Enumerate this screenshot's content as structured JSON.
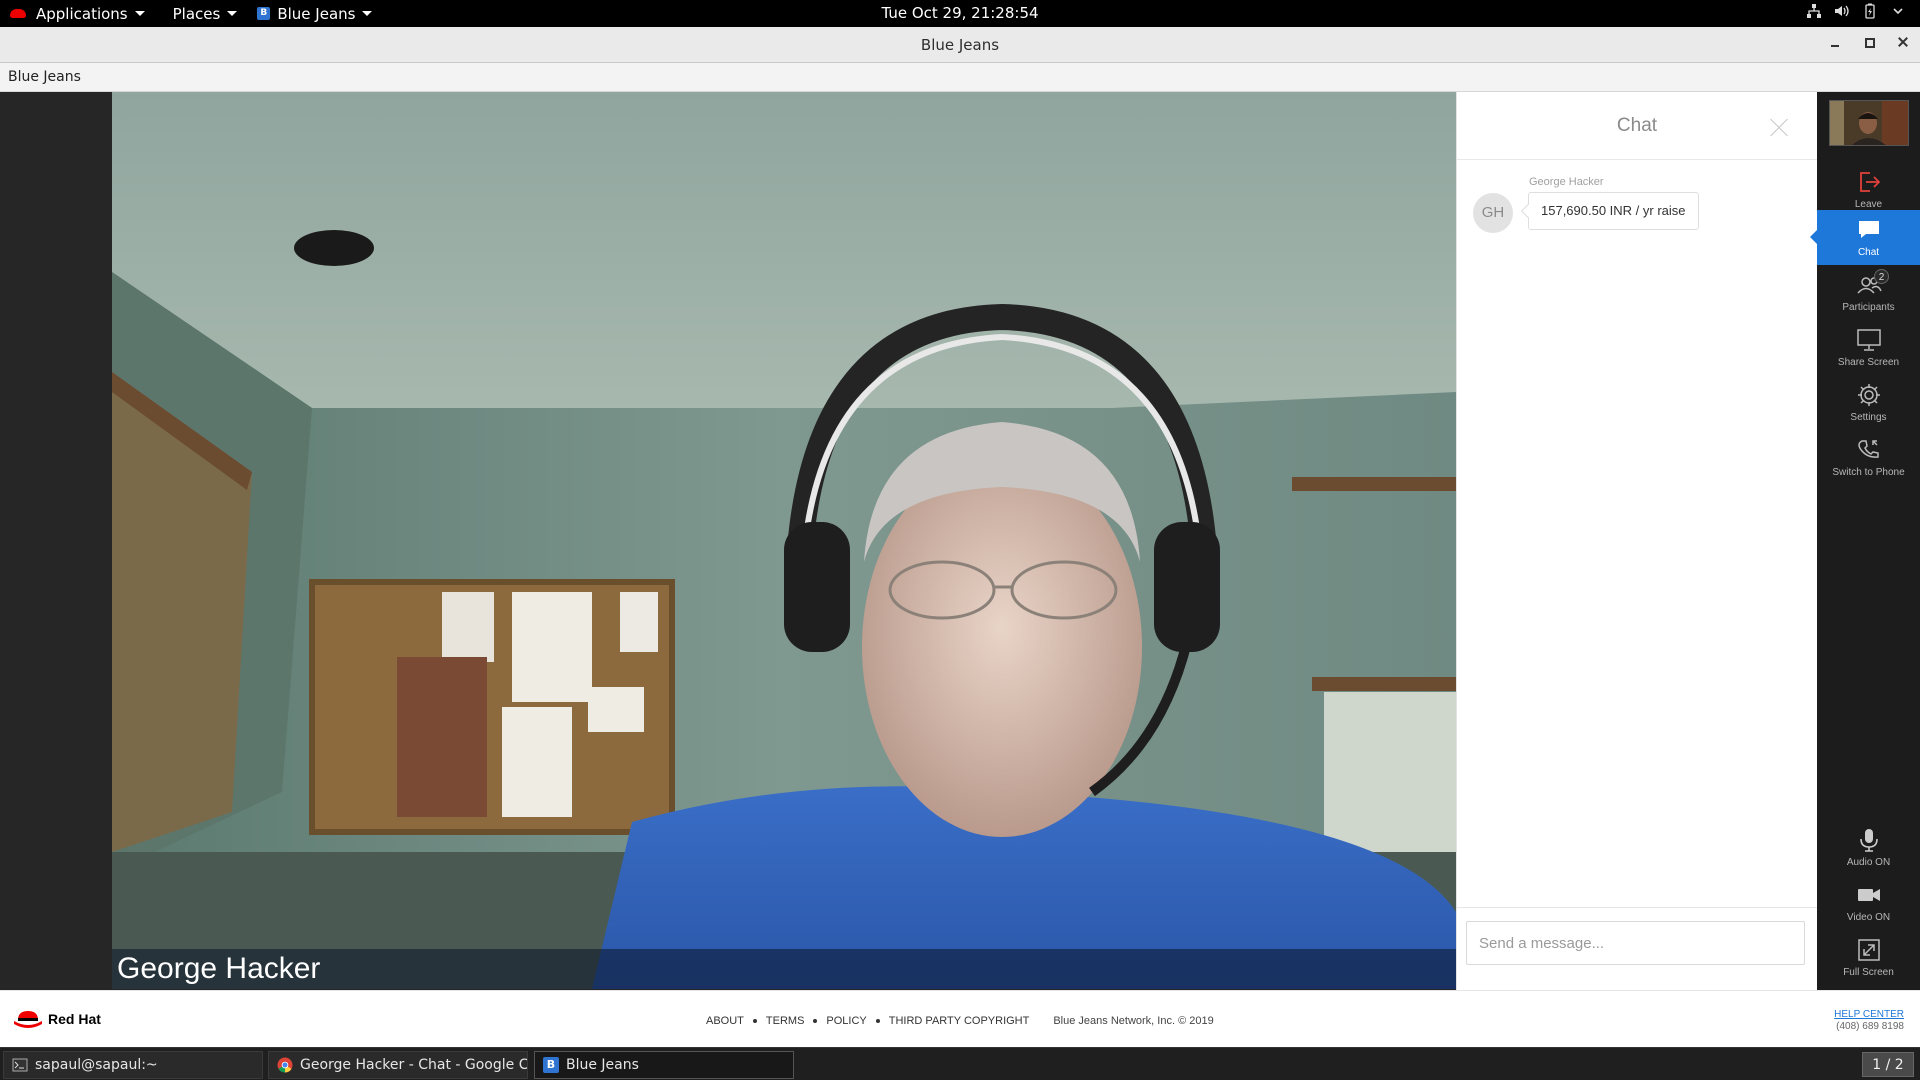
{
  "topbar": {
    "applications_label": "Applications",
    "places_label": "Places",
    "active_app_label": "Blue Jeans",
    "clock": "Tue Oct 29, 21:28:54"
  },
  "window": {
    "title": "Blue Jeans",
    "tab_label": "Blue Jeans"
  },
  "video": {
    "participant_name": "George Hacker"
  },
  "chat": {
    "title": "Chat",
    "messages": [
      {
        "sender": "George Hacker",
        "initials": "GH",
        "text": "157,690.50 INR / yr raise"
      }
    ],
    "input_placeholder": "Send a message..."
  },
  "toolbar": {
    "items": [
      {
        "label": "Leave",
        "icon": "leave-icon"
      },
      {
        "label": "Chat",
        "icon": "chat-icon",
        "active": true
      },
      {
        "label": "Participants",
        "icon": "participants-icon",
        "badge": "2"
      },
      {
        "label": "Share Screen",
        "icon": "share-screen-icon"
      },
      {
        "label": "Settings",
        "icon": "settings-icon"
      },
      {
        "label": "Switch to Phone",
        "icon": "phone-icon"
      },
      {
        "label": "Audio ON",
        "icon": "microphone-icon"
      },
      {
        "label": "Video ON",
        "icon": "video-camera-icon"
      },
      {
        "label": "Full Screen",
        "icon": "fullscreen-icon"
      }
    ],
    "active_color": "#1e78d9"
  },
  "footer": {
    "brand": "Red Hat",
    "links": [
      "ABOUT",
      "TERMS",
      "POLICY",
      "THIRD PARTY COPYRIGHT"
    ],
    "copyright": "Blue Jeans Network, Inc. © 2019",
    "help_center": "HELP CENTER",
    "phone": "(408) 689 8198"
  },
  "taskbar": {
    "tasks": [
      {
        "label": "sapaul@sapaul:~",
        "icon": "terminal-icon"
      },
      {
        "label": "George Hacker - Chat - Google C...",
        "icon": "chrome-icon"
      },
      {
        "label": "Blue Jeans",
        "icon": "bluejeans-icon",
        "active": true
      }
    ],
    "workspace": "1 / 2"
  }
}
